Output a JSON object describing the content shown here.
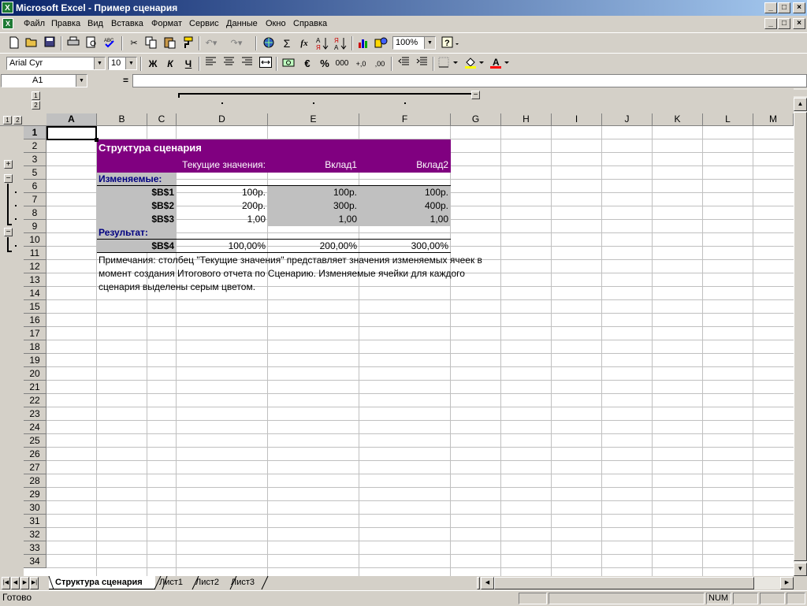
{
  "window": {
    "title": "Microsoft Excel - Пример сценария",
    "app_icon": "excel-icon",
    "caption_buttons": [
      "_",
      "□",
      "×"
    ],
    "doc_buttons": [
      "_",
      "□",
      "×"
    ]
  },
  "menu": [
    "Файл",
    "Правка",
    "Вид",
    "Вставка",
    "Формат",
    "Сервис",
    "Данные",
    "Окно",
    "Справка"
  ],
  "toolbar": {
    "zoom": "100%",
    "font_name": "Arial Cyr",
    "font_size": "10",
    "bold": "Ж",
    "italic": "К",
    "underline": "Ч",
    "currency": "€",
    "percent": "%",
    "thousands": "000",
    "inc_decimal": "+,0",
    "dec_decimal": ",00",
    "sum": "Σ",
    "fx": "fx",
    "font_color_label": "A"
  },
  "formula_bar": {
    "name_box": "A1",
    "equals": "=",
    "content": ""
  },
  "outline": {
    "level_buttons_rows": [
      "1",
      "2"
    ],
    "level_buttons_cols": [
      "1",
      "2"
    ],
    "row_group_toggles": [
      "+",
      "−",
      "−"
    ],
    "col_group_toggle": "−"
  },
  "columns": [
    "A",
    "B",
    "C",
    "D",
    "E",
    "F",
    "G",
    "H",
    "I",
    "J",
    "K",
    "L",
    "M"
  ],
  "rows": [
    "1",
    "2",
    "3",
    "5",
    "6",
    "7",
    "8",
    "9",
    "10",
    "11",
    "12",
    "13",
    "14",
    "15",
    "16",
    "17",
    "18",
    "19",
    "20",
    "21",
    "22",
    "23",
    "24",
    "25",
    "26",
    "27",
    "28",
    "29",
    "30",
    "31",
    "32",
    "33",
    "34"
  ],
  "report": {
    "title": "Структура сценария",
    "header_current": "Текущие значения:",
    "header_s1": "Вклад1",
    "header_s2": "Вклад2",
    "changing_label": "Изменяемые:",
    "changing": [
      {
        "ref": "$B$1",
        "current": "100р.",
        "s1": "100р.",
        "s2": "100р."
      },
      {
        "ref": "$B$2",
        "current": "200р.",
        "s1": "300р.",
        "s2": "400р."
      },
      {
        "ref": "$B$3",
        "current": "1,00",
        "s1": "1,00",
        "s2": "1,00"
      }
    ],
    "result_label": "Результат:",
    "result": {
      "ref": "$B$4",
      "current": "100,00%",
      "s1": "200,00%",
      "s2": "300,00%"
    },
    "notes": [
      "Примечания: столбец \"Текущие значения\" представляет значения изменяемых ячеек в",
      "момент создания Итогового отчета по Сценарию. Изменяемые ячейки для каждого",
      "сценария выделены серым цветом."
    ]
  },
  "sheet_tabs": [
    "Структура сценария",
    "Лист1",
    "Лист2",
    "Лист3"
  ],
  "status": {
    "ready": "Готово",
    "num": "NUM"
  },
  "colors": {
    "title_bg": "#800080",
    "title_text": "#ffffff",
    "label_blue": "#000080",
    "highlight": "#c0c0c0"
  }
}
